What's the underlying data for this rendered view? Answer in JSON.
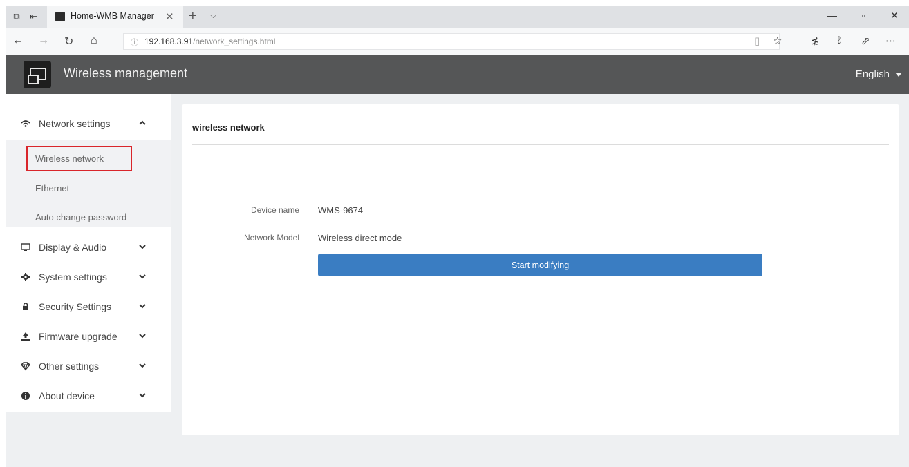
{
  "browser": {
    "tab_title": "Home-WMB Manager",
    "url_host": "192.168.3.91",
    "url_path": "/network_settings.html"
  },
  "app": {
    "title": "Wireless management",
    "language": "English"
  },
  "sidebar": {
    "items": [
      {
        "label": "Network settings",
        "icon": "wifi-icon",
        "expanded": true,
        "subitems": [
          {
            "label": "Wireless network",
            "selected": true
          },
          {
            "label": "Ethernet"
          },
          {
            "label": "Auto change password"
          }
        ]
      },
      {
        "label": "Display & Audio",
        "icon": "monitor-icon"
      },
      {
        "label": "System settings",
        "icon": "gear-icon"
      },
      {
        "label": "Security Settings",
        "icon": "lock-icon"
      },
      {
        "label": "Firmware upgrade",
        "icon": "upload-icon"
      },
      {
        "label": "Other settings",
        "icon": "diamond-icon"
      },
      {
        "label": "About device",
        "icon": "info-icon"
      }
    ]
  },
  "content": {
    "section_title": "wireless network",
    "fields": [
      {
        "label": "Device name",
        "value": "WMS-9674"
      },
      {
        "label": "Network Model",
        "value": "Wireless direct mode"
      }
    ],
    "start_button": "Start modifying"
  },
  "colors": {
    "header_bg": "#555657",
    "primary_button": "#3a7dc2",
    "selection_outline": "#d9262b"
  }
}
